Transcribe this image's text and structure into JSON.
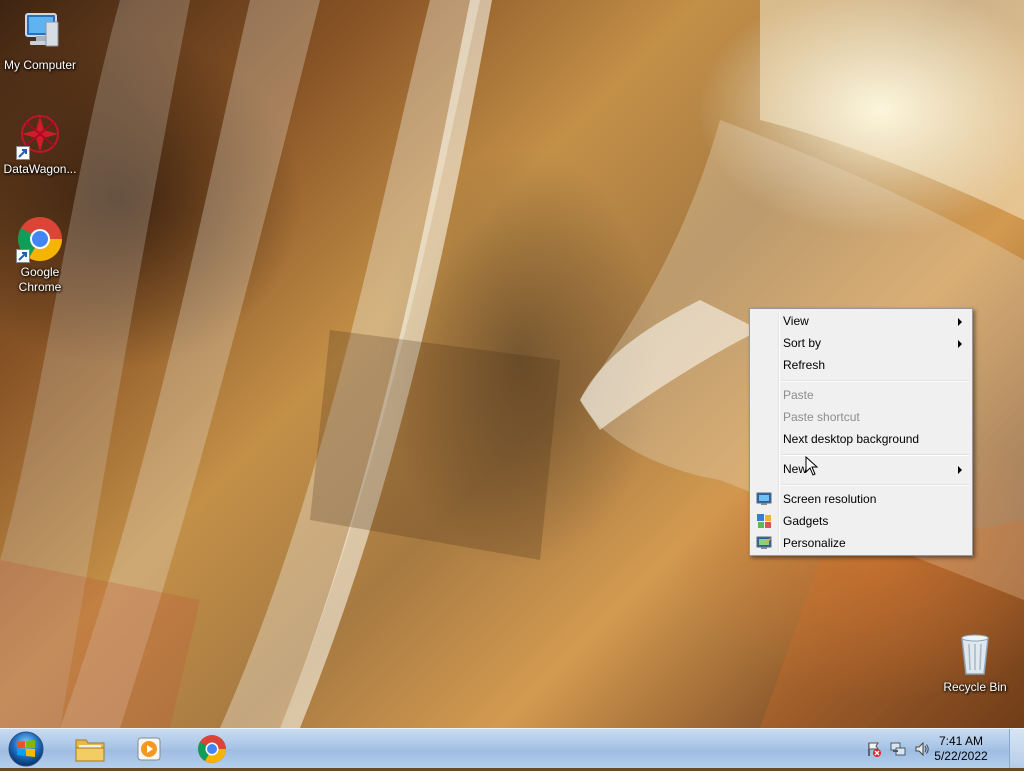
{
  "desktop": {
    "icons": [
      {
        "label": "My Computer",
        "icon": "computer-icon",
        "shortcut": false
      },
      {
        "label": "DataWagon...",
        "icon": "datawagon-icon",
        "shortcut": true
      },
      {
        "label": "Google Chrome",
        "icon": "chrome-icon",
        "shortcut": true
      },
      {
        "label": "Recycle Bin",
        "icon": "recycle-bin-icon",
        "shortcut": false
      }
    ]
  },
  "context_menu": {
    "items": [
      {
        "label": "View",
        "submenu": true,
        "enabled": true
      },
      {
        "label": "Sort by",
        "submenu": true,
        "enabled": true
      },
      {
        "label": "Refresh",
        "submenu": false,
        "enabled": true
      },
      {
        "label": "Paste",
        "submenu": false,
        "enabled": false
      },
      {
        "label": "Paste shortcut",
        "submenu": false,
        "enabled": false
      },
      {
        "label": "Next desktop background",
        "submenu": false,
        "enabled": true
      },
      {
        "label": "New",
        "submenu": true,
        "enabled": true
      },
      {
        "label": "Screen resolution",
        "submenu": false,
        "enabled": true,
        "icon": "display-icon"
      },
      {
        "label": "Gadgets",
        "submenu": false,
        "enabled": true,
        "icon": "gadgets-icon"
      },
      {
        "label": "Personalize",
        "submenu": false,
        "enabled": true,
        "icon": "personalize-icon"
      }
    ]
  },
  "taskbar": {
    "pinned": [
      {
        "name": "windows-explorer",
        "icon": "folder-icon"
      },
      {
        "name": "media-player",
        "icon": "media-player-icon"
      },
      {
        "name": "google-chrome",
        "icon": "chrome-icon"
      }
    ],
    "tray_icons": [
      "action-center-icon",
      "network-icon",
      "volume-icon"
    ],
    "clock": {
      "time": "7:41 AM",
      "date": "5/22/2022"
    }
  },
  "colors": {
    "taskbar": "#a9c6e6",
    "menu_background": "#f0f0f0",
    "menu_disabled_text": "#8d8d8d"
  }
}
